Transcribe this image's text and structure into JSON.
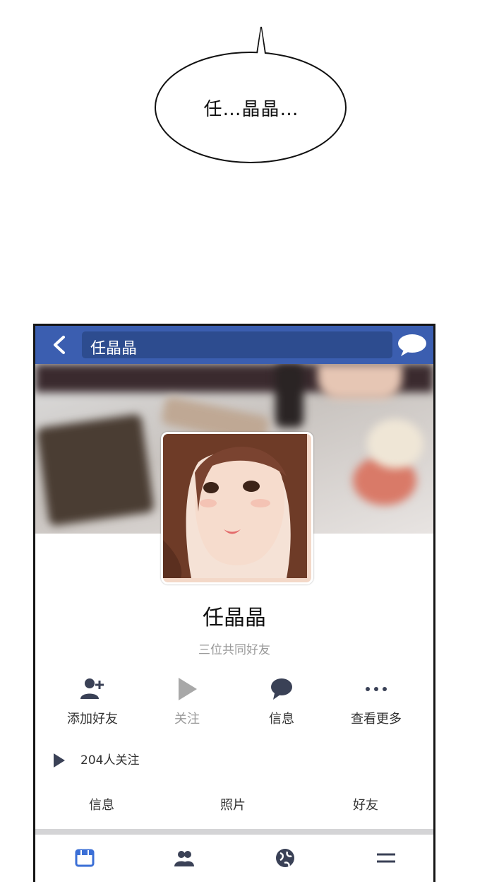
{
  "bubble": {
    "text": "任…晶晶…"
  },
  "header": {
    "title": "任晶晶"
  },
  "profile": {
    "name": "任晶晶",
    "mutual_friends": "三位共同好友"
  },
  "actions": [
    {
      "label": "添加好友",
      "icon": "add-friend-icon"
    },
    {
      "label": "关注",
      "icon": "play-icon"
    },
    {
      "label": "信息",
      "icon": "message-icon"
    },
    {
      "label": "查看更多",
      "icon": "more-icon"
    }
  ],
  "followers": {
    "text": "204人关注"
  },
  "tabs": [
    {
      "label": "信息"
    },
    {
      "label": "照片"
    },
    {
      "label": "好友"
    }
  ],
  "bottom_nav": [
    {
      "icon": "news-feed-icon",
      "active": true
    },
    {
      "icon": "friends-icon",
      "active": false
    },
    {
      "icon": "globe-icon",
      "active": false
    },
    {
      "icon": "menu-icon",
      "active": false
    }
  ],
  "colors": {
    "brand": "#3b5eb0",
    "title_field": "#2d4c8f",
    "icon_dark": "#3a4156",
    "active_icon": "#3b6fd6"
  }
}
